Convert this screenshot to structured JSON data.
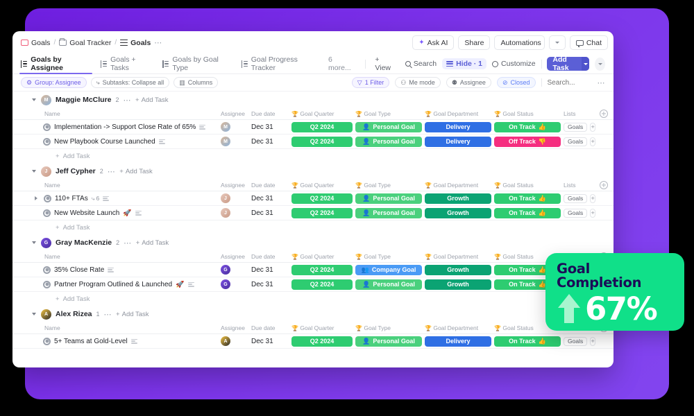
{
  "theme": {
    "backdrop_purple": "#7c33ea",
    "accent_blue": "#5b5fd6",
    "green": "#2ecc71",
    "badge_green": "#10E089"
  },
  "breadcrumb": {
    "items": [
      {
        "label": "Goals",
        "icon": "screen-icon"
      },
      {
        "label": "Goal Tracker",
        "icon": "folder-icon"
      },
      {
        "label": "Goals",
        "icon": "list-icon"
      }
    ],
    "overflow": "⋯"
  },
  "topbar": {
    "ask_ai": "Ask AI",
    "share": "Share",
    "automations": "Automations",
    "chat": "Chat"
  },
  "view_tabs": [
    {
      "label": "Goals by Assignee",
      "active": true
    },
    {
      "label": "Goals + Tasks",
      "active": false
    },
    {
      "label": "Goals by Goal Type",
      "active": false
    },
    {
      "label": "Goal Progress Tracker",
      "active": false
    }
  ],
  "view_more": "6 more...",
  "view_add": "+ View",
  "toolbar": {
    "search": "Search",
    "hide": "Hide · 1",
    "customize": "Customize",
    "add_task": "Add Task"
  },
  "filterbar": {
    "group": "Group: Assignee",
    "subtasks": "Subtasks: Collapse all",
    "columns": "Columns",
    "filter": "1 Filter",
    "me_mode": "Me mode",
    "assignee": "Assignee",
    "closed": "Closed",
    "search_placeholder": "Search...",
    "overflow": "⋯"
  },
  "columns": {
    "name": "Name",
    "assignee": "Assignee",
    "due_date": "Due date",
    "goal_quarter": "Goal Quarter",
    "goal_type": "Goal Type",
    "goal_department": "Goal Department",
    "goal_status": "Goal Status",
    "lists": "Lists"
  },
  "add_task_label": "Add Task",
  "lists_value": "Goals",
  "groups": [
    {
      "name": "Maggie McClure",
      "count": "2",
      "avatar_colors": [
        "#d9b89a",
        "#8fb3d9"
      ],
      "avatar_initial": "M",
      "tasks": [
        {
          "name": "Implementation -> Support Close Rate of 65%",
          "has_subtasks": false,
          "subtask_count": "",
          "emoji": "",
          "due": "Dec 31",
          "quarter": "Q2 2024",
          "quarter_color": "#2ecc71",
          "type": "Personal Goal",
          "type_icon": "👤",
          "type_color": "#4ad07d",
          "dept": "Delivery",
          "dept_color": "#2f6fe4",
          "status": "On Track",
          "status_icon": "👍",
          "status_color": "#2ecc71",
          "lists": "Goals"
        },
        {
          "name": "New Playbook Course Launched",
          "has_subtasks": false,
          "subtask_count": "",
          "emoji": "",
          "due": "Dec 31",
          "quarter": "Q2 2024",
          "quarter_color": "#2ecc71",
          "type": "Personal Goal",
          "type_icon": "👤",
          "type_color": "#4ad07d",
          "dept": "Delivery",
          "dept_color": "#2f6fe4",
          "status": "Off Track",
          "status_icon": "👎",
          "status_color": "#f52e80",
          "lists": "Goals"
        }
      ]
    },
    {
      "name": "Jeff Cypher",
      "count": "2",
      "avatar_colors": [
        "#e8c9bd",
        "#c99a86"
      ],
      "avatar_initial": "J",
      "tasks": [
        {
          "name": "110+ FTAs",
          "has_subtasks": true,
          "subtask_count": "6",
          "emoji": "",
          "due": "Dec 31",
          "quarter": "Q2 2024",
          "quarter_color": "#2ecc71",
          "type": "Personal Goal",
          "type_icon": "👤",
          "type_color": "#4ad07d",
          "dept": "Growth",
          "dept_color": "#0ba373",
          "status": "On Track",
          "status_icon": "👍",
          "status_color": "#2ecc71",
          "lists": "Goals"
        },
        {
          "name": "New Website Launch",
          "has_subtasks": false,
          "subtask_count": "",
          "emoji": "🚀",
          "due": "Dec 31",
          "quarter": "Q2 2024",
          "quarter_color": "#2ecc71",
          "type": "Personal Goal",
          "type_icon": "👤",
          "type_color": "#4ad07d",
          "dept": "Growth",
          "dept_color": "#0ba373",
          "status": "On Track",
          "status_icon": "👍",
          "status_color": "#2ecc71",
          "lists": "Goals"
        }
      ]
    },
    {
      "name": "Gray MacKenzie",
      "count": "2",
      "avatar_colors": [
        "#7b4fe0",
        "#4a2fa0"
      ],
      "avatar_initial": "G",
      "tasks": [
        {
          "name": "35% Close Rate",
          "has_subtasks": false,
          "subtask_count": "",
          "emoji": "",
          "due": "Dec 31",
          "quarter": "Q2 2024",
          "quarter_color": "#2ecc71",
          "type": "Company Goal",
          "type_icon": "👥",
          "type_color": "#4a9bf5",
          "dept": "Growth",
          "dept_color": "#0ba373",
          "status": "On Track",
          "status_icon": "👍",
          "status_color": "#2ecc71",
          "lists": "Goals"
        },
        {
          "name": "Partner Program Outlined & Launched",
          "has_subtasks": false,
          "subtask_count": "",
          "emoji": "🚀",
          "due": "Dec 31",
          "quarter": "Q2 2024",
          "quarter_color": "#2ecc71",
          "type": "Personal Goal",
          "type_icon": "👤",
          "type_color": "#4ad07d",
          "dept": "Growth",
          "dept_color": "#0ba373",
          "status": "On Track",
          "status_icon": "👍",
          "status_color": "#2ecc71",
          "lists": "Goals"
        }
      ]
    },
    {
      "name": "Alex Rizea",
      "count": "1",
      "avatar_colors": [
        "#f5c542",
        "#2a2a2a"
      ],
      "avatar_initial": "A",
      "tasks": [
        {
          "name": "5+ Teams at Gold-Level",
          "has_subtasks": false,
          "subtask_count": "",
          "emoji": "",
          "due": "Dec 31",
          "quarter": "Q2 2024",
          "quarter_color": "#2ecc71",
          "type": "Personal Goal",
          "type_icon": "👤",
          "type_color": "#4ad07d",
          "dept": "Delivery",
          "dept_color": "#2f6fe4",
          "status": "On Track",
          "status_icon": "👍",
          "status_color": "#2ecc71",
          "lists": "Goals"
        }
      ]
    }
  ],
  "goal_badge": {
    "title": "Goal Completion",
    "value": "67%",
    "arrow": "up-arrow-icon"
  }
}
